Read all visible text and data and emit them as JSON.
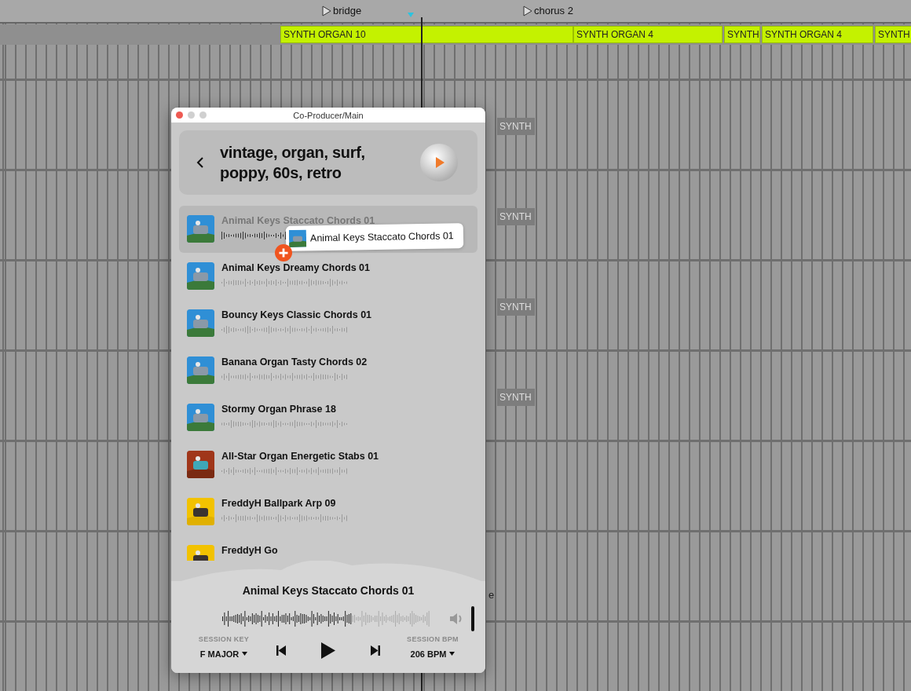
{
  "timeline": {
    "locators": [
      {
        "label": "bridge"
      },
      {
        "label": "chorus 2"
      }
    ],
    "clips": [
      {
        "name": "SYNTH ORGAN 10"
      },
      {
        "name": "SYNTH ORGAN 4"
      },
      {
        "name": "SYNTH"
      },
      {
        "name": "SYNTH ORGAN 4"
      },
      {
        "name": "SYNTH"
      }
    ],
    "track_clips": [
      {
        "name": "SYNTH"
      },
      {
        "name": "SYNTH"
      },
      {
        "name": "SYNTH"
      },
      {
        "name": "SYNTH"
      }
    ],
    "cut_label": "e"
  },
  "window": {
    "title": "Co-Producer/Main"
  },
  "header": {
    "title": "vintage, organ, surf, poppy, 60s, retro"
  },
  "samples": [
    {
      "name": "Animal Keys Staccato Chords 01",
      "selected": true
    },
    {
      "name": "Animal Keys Dreamy Chords 01",
      "selected": false
    },
    {
      "name": "Bouncy Keys Classic Chords 01",
      "selected": false
    },
    {
      "name": "Banana Organ Tasty Chords 02",
      "selected": false
    },
    {
      "name": "Stormy Organ Phrase 18",
      "selected": false
    },
    {
      "name": "All-Star Organ Energetic Stabs 01",
      "selected": false
    },
    {
      "name": "FreddyH Ballpark Arp 09",
      "selected": false
    },
    {
      "name": "FreddyH Go",
      "selected": false
    }
  ],
  "drag": {
    "name": "Animal Keys Staccato Chords 01"
  },
  "player": {
    "title": "Animal Keys Staccato Chords 01",
    "key_label": "SESSION KEY",
    "key": "F MAJOR",
    "bpm_label": "SESSION BPM",
    "bpm": "206 BPM"
  }
}
